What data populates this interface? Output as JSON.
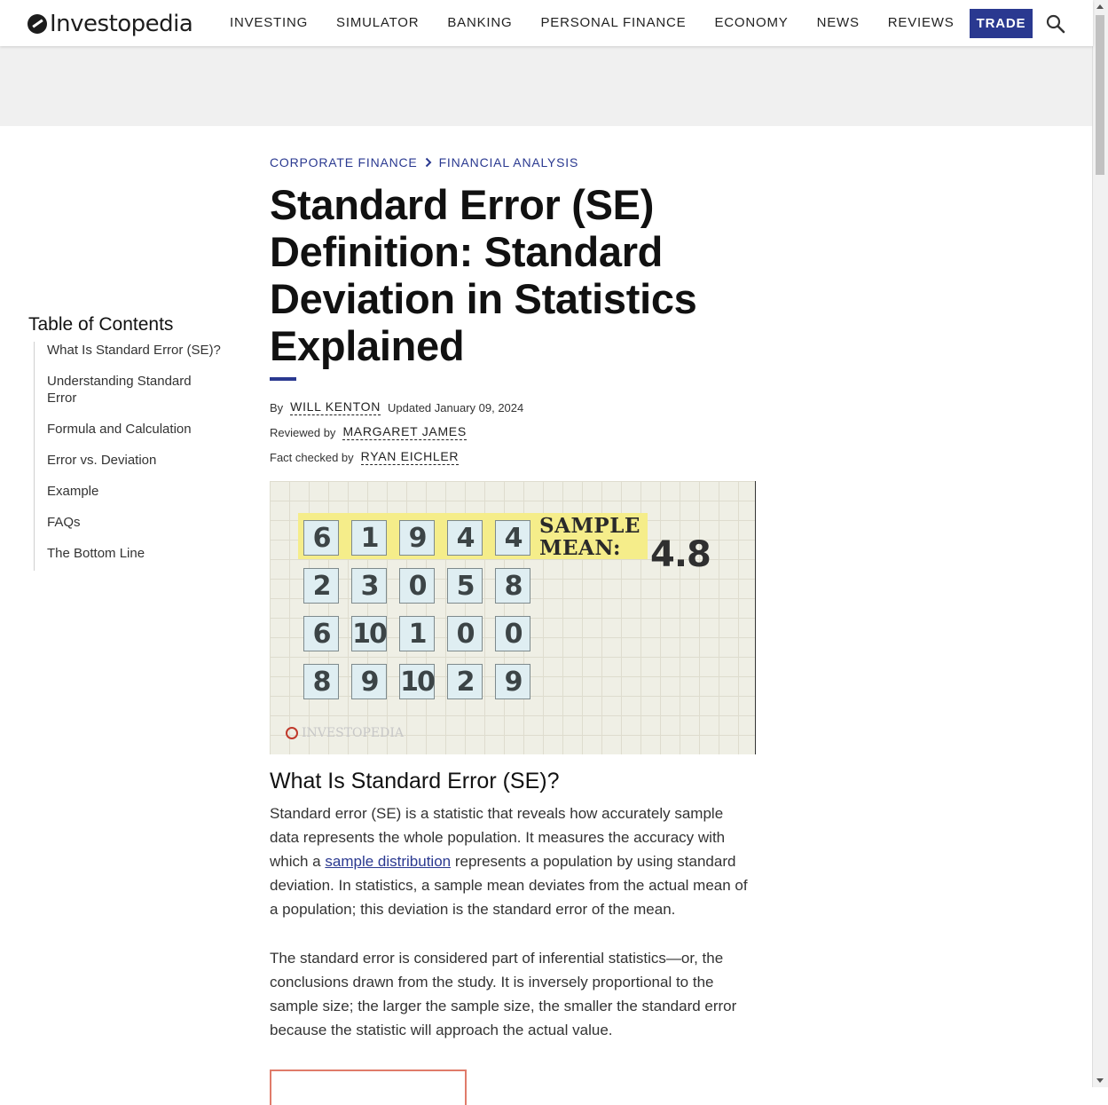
{
  "header": {
    "logo_text": "Investopedia",
    "nav": [
      "INVESTING",
      "SIMULATOR",
      "BANKING",
      "PERSONAL FINANCE",
      "ECONOMY",
      "NEWS",
      "REVIEWS"
    ],
    "trade_label": "TRADE",
    "search_icon": "search-icon",
    "accent_color": "#2a3990"
  },
  "toc": {
    "title": "Table of Contents",
    "items": [
      "What Is Standard Error (SE)?",
      "Understanding Standard Error",
      "Formula and Calculation",
      "Error vs. Deviation",
      "Example",
      "FAQs",
      "The Bottom Line"
    ]
  },
  "article": {
    "breadcrumbs": [
      "CORPORATE FINANCE",
      "FINANCIAL ANALYSIS"
    ],
    "title": "Standard Error (SE) Definition: Standard Deviation in Statistics Explained",
    "byline": {
      "by_label": "By",
      "author": "WILL KENTON",
      "updated": "Updated January 09, 2024",
      "reviewed_label": "Reviewed by",
      "reviewer": "MARGARET JAMES",
      "factcheck_label": "Fact checked by",
      "factchecker": "RYAN EICHLER"
    },
    "hero": {
      "rows": [
        [
          "6",
          "1",
          "9",
          "4",
          "4"
        ],
        [
          "2",
          "3",
          "0",
          "5",
          "8"
        ],
        [
          "6",
          "10",
          "1",
          "0",
          "0"
        ],
        [
          "8",
          "9",
          "10",
          "2",
          "9"
        ]
      ],
      "sample_label_line1": "SAMPLE",
      "sample_label_line2": "MEAN:",
      "sample_value": "4.8",
      "watermark": "INVESTOPEDIA"
    },
    "section_heading": "What Is Standard Error (SE)?",
    "para1_before": "Standard error (SE) is a statistic that reveals how accurately sample data represents the whole population. It measures the accuracy with which a ",
    "para1_link": "sample distribution",
    "para1_after": " represents a population by using standard deviation. In statistics, a sample mean deviates from the actual mean of a population; this deviation is the standard error of the mean.",
    "para2": "The standard error is considered part of inferential statistics—or, the conclusions drawn from the study. It is inversely proportional to the sample size; the larger the sample size, the smaller the standard error because the statistic will approach the actual value."
  }
}
